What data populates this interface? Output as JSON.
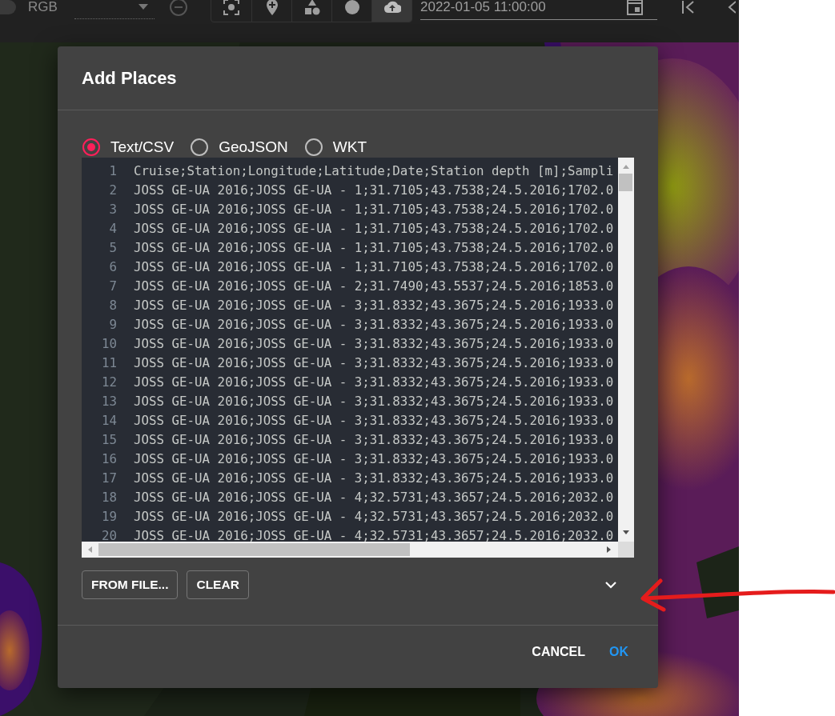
{
  "toolbar": {
    "switch": {
      "on": false
    },
    "layer_label": "RGB",
    "tools": [
      {
        "kind": "focus",
        "selected": false
      },
      {
        "kind": "pin",
        "selected": false
      },
      {
        "kind": "shapes",
        "selected": false
      },
      {
        "kind": "circle",
        "selected": false
      },
      {
        "kind": "upload",
        "selected": true
      }
    ],
    "time": "2022-01-05 11:00:00"
  },
  "dialog": {
    "title": "Add Places",
    "formats": [
      {
        "label": "Text/CSV",
        "selected": true
      },
      {
        "label": "GeoJSON",
        "selected": false
      },
      {
        "label": "WKT",
        "selected": false
      }
    ],
    "editor": {
      "lines": [
        {
          "number": "1",
          "text": "Cruise;Station;Longitude;Latitude;Date;Station depth [m];Sampli"
        },
        {
          "number": "2",
          "text": "JOSS GE-UA 2016;JOSS GE-UA - 1;31.7105;43.7538;24.5.2016;1702.0"
        },
        {
          "number": "3",
          "text": "JOSS GE-UA 2016;JOSS GE-UA - 1;31.7105;43.7538;24.5.2016;1702.0"
        },
        {
          "number": "4",
          "text": "JOSS GE-UA 2016;JOSS GE-UA - 1;31.7105;43.7538;24.5.2016;1702.0"
        },
        {
          "number": "5",
          "text": "JOSS GE-UA 2016;JOSS GE-UA - 1;31.7105;43.7538;24.5.2016;1702.0"
        },
        {
          "number": "6",
          "text": "JOSS GE-UA 2016;JOSS GE-UA - 1;31.7105;43.7538;24.5.2016;1702.0"
        },
        {
          "number": "7",
          "text": "JOSS GE-UA 2016;JOSS GE-UA - 2;31.7490;43.5537;24.5.2016;1853.0"
        },
        {
          "number": "8",
          "text": "JOSS GE-UA 2016;JOSS GE-UA - 3;31.8332;43.3675;24.5.2016;1933.0"
        },
        {
          "number": "9",
          "text": "JOSS GE-UA 2016;JOSS GE-UA - 3;31.8332;43.3675;24.5.2016;1933.0"
        },
        {
          "number": "10",
          "text": "JOSS GE-UA 2016;JOSS GE-UA - 3;31.8332;43.3675;24.5.2016;1933.0"
        },
        {
          "number": "11",
          "text": "JOSS GE-UA 2016;JOSS GE-UA - 3;31.8332;43.3675;24.5.2016;1933.0"
        },
        {
          "number": "12",
          "text": "JOSS GE-UA 2016;JOSS GE-UA - 3;31.8332;43.3675;24.5.2016;1933.0"
        },
        {
          "number": "13",
          "text": "JOSS GE-UA 2016;JOSS GE-UA - 3;31.8332;43.3675;24.5.2016;1933.0"
        },
        {
          "number": "14",
          "text": "JOSS GE-UA 2016;JOSS GE-UA - 3;31.8332;43.3675;24.5.2016;1933.0"
        },
        {
          "number": "15",
          "text": "JOSS GE-UA 2016;JOSS GE-UA - 3;31.8332;43.3675;24.5.2016;1933.0"
        },
        {
          "number": "16",
          "text": "JOSS GE-UA 2016;JOSS GE-UA - 3;31.8332;43.3675;24.5.2016;1933.0"
        },
        {
          "number": "17",
          "text": "JOSS GE-UA 2016;JOSS GE-UA - 3;31.8332;43.3675;24.5.2016;1933.0"
        },
        {
          "number": "18",
          "text": "JOSS GE-UA 2016;JOSS GE-UA - 4;32.5731;43.3657;24.5.2016;2032.0"
        },
        {
          "number": "19",
          "text": "JOSS GE-UA 2016;JOSS GE-UA - 4;32.5731;43.3657;24.5.2016;2032.0"
        },
        {
          "number": "20",
          "text": "JOSS GE-UA 2016;JOSS GE-UA - 4;32.5731;43.3657;24.5.2016;2032.0"
        }
      ]
    },
    "tool_buttons": [
      "FROM FILE...",
      "CLEAR"
    ],
    "options": {
      "expanded": false
    },
    "actions": [
      {
        "label": "CANCEL",
        "kind": "secondary"
      },
      {
        "label": "OK",
        "kind": "primary"
      }
    ]
  }
}
